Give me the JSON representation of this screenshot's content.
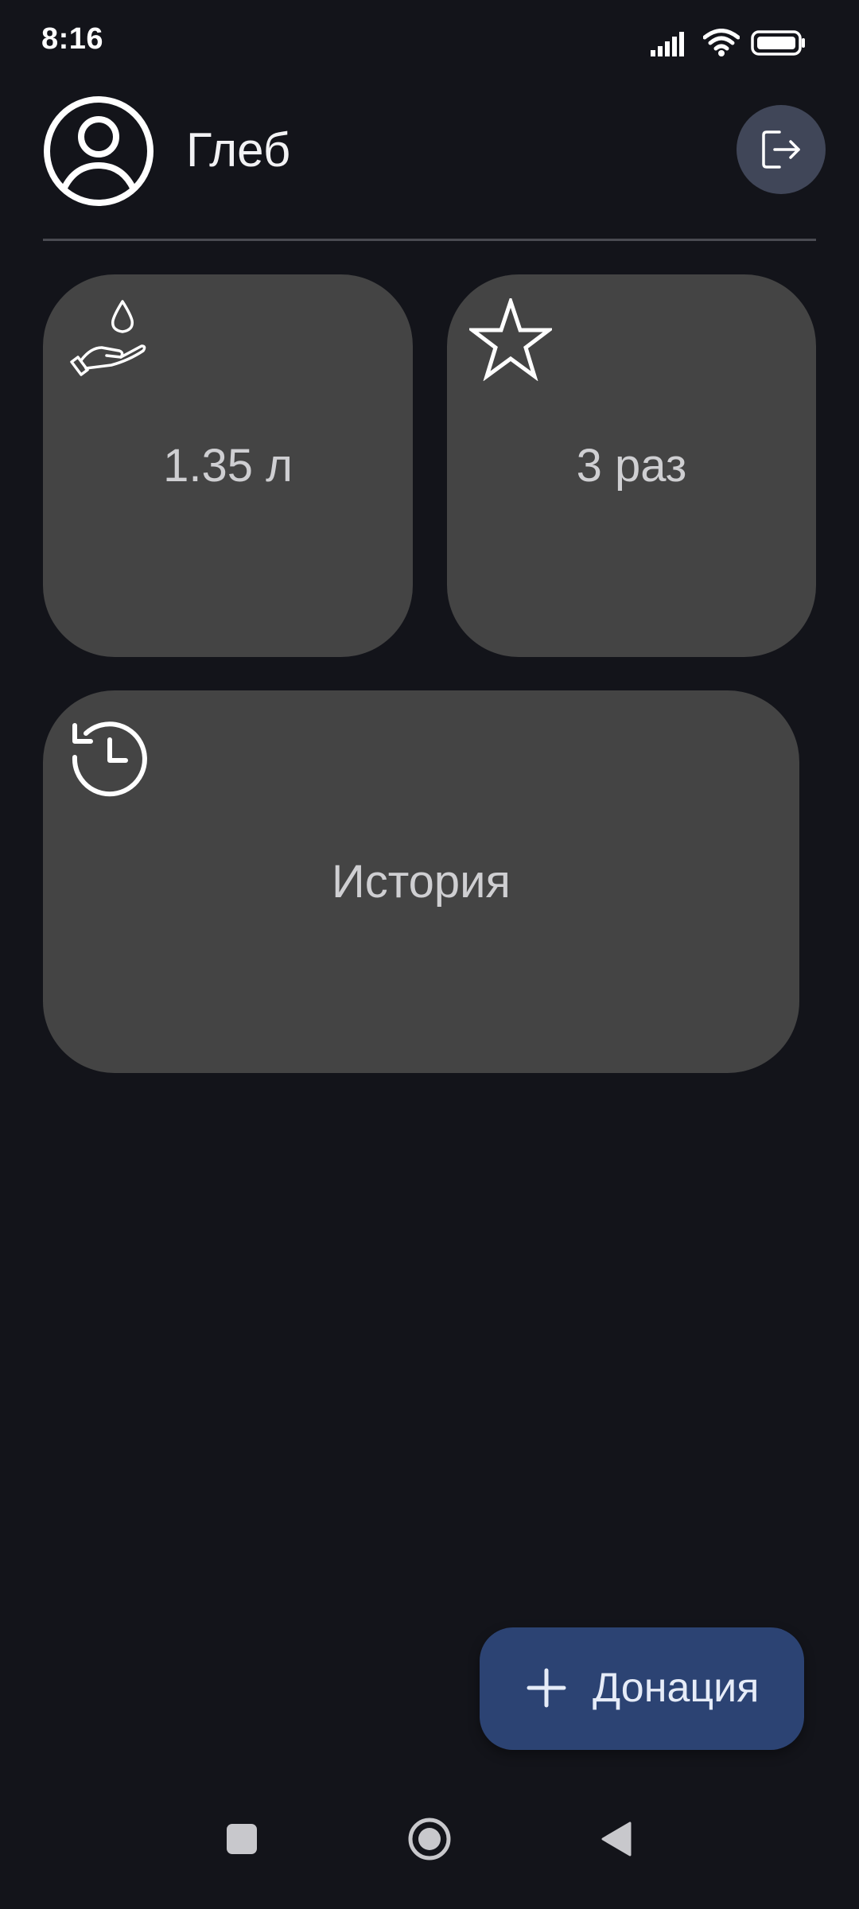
{
  "status_bar": {
    "time": "8:16",
    "icons": [
      "signal-icon",
      "wifi-icon",
      "battery-icon"
    ]
  },
  "header": {
    "user_name": "Глеб",
    "avatar_icon": "user-circle-icon",
    "logout_icon": "logout-icon"
  },
  "cards": {
    "volume": {
      "icon": "hand-drop-icon",
      "value": "1.35 л"
    },
    "count": {
      "icon": "star-icon",
      "value": "3 раз"
    },
    "history": {
      "icon": "history-icon",
      "label": "История"
    }
  },
  "fab": {
    "icon": "plus-icon",
    "label": "Донация"
  },
  "nav_bar": {
    "buttons": [
      "recents-square-icon",
      "home-circle-icon",
      "back-triangle-icon"
    ]
  },
  "colors": {
    "background": "#13141a",
    "card": "#444444",
    "fab": "#2c4373",
    "logout_button": "#404658"
  }
}
